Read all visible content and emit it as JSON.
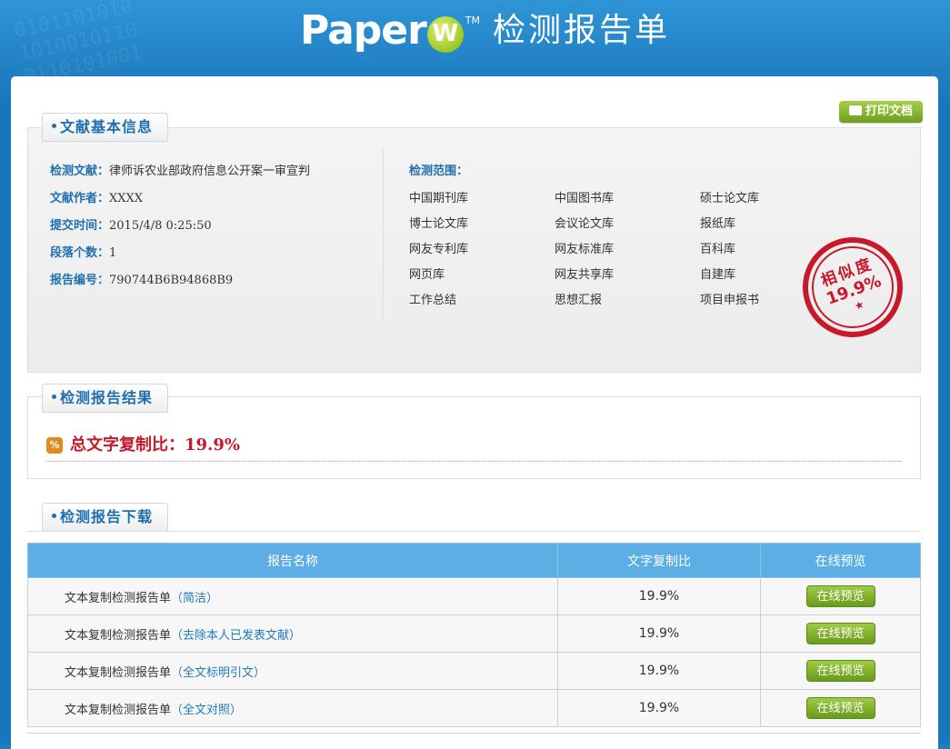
{
  "header": {
    "logo_text": "Paper",
    "logo_mark": "W",
    "logo_tm": "TM",
    "title": "检测报告单"
  },
  "toolbar": {
    "print_label": "打印文档"
  },
  "info": {
    "section_title": "文献基本信息",
    "rows": [
      {
        "label": "检测文献：",
        "value": "律师诉农业部政府信息公开案一审宣判"
      },
      {
        "label": "文献作者：",
        "value": "XXXX"
      },
      {
        "label": "提交时间：",
        "value": "2015/4/8 0:25:50"
      },
      {
        "label": "段落个数：",
        "value": "1"
      },
      {
        "label": "报告编号：",
        "value": "790744B6B94868B9"
      }
    ],
    "scope_label": "检测范围：",
    "scope": [
      "中国期刊库",
      "中国图书库",
      "硕士论文库",
      "博士论文库",
      "会议论文库",
      "报纸库",
      "网友专利库",
      "网友标准库",
      "百科库",
      "网页库",
      "网友共享库",
      "自建库",
      "工作总结",
      "思想汇报",
      "项目申报书"
    ],
    "stamp": {
      "title": "相似度",
      "value": "19.9%",
      "star": "★"
    }
  },
  "result": {
    "section_title": "检测报告结果",
    "icon": "%",
    "label": "总文字复制比：",
    "value": "19.9%"
  },
  "download": {
    "section_title": "检测报告下载",
    "columns": [
      "报告名称",
      "文字复制比",
      "在线预览"
    ],
    "rows": [
      {
        "name": "文本复制检测报告单",
        "sub": "（简洁）",
        "ratio": "19.9%",
        "action": "在线预览"
      },
      {
        "name": "文本复制检测报告单",
        "sub": "（去除本人已发表文献）",
        "ratio": "19.9%",
        "action": "在线预览"
      },
      {
        "name": "文本复制检测报告单",
        "sub": "（全文标明引文）",
        "ratio": "19.9%",
        "action": "在线预览"
      },
      {
        "name": "文本复制检测报告单",
        "sub": "（全文对照）",
        "ratio": "19.9%",
        "action": "在线预览"
      }
    ]
  },
  "colors": {
    "accent": "#1f6fb0",
    "header_bg": "#1a76ba",
    "table_head": "#5eaee6",
    "stamp": "#c8192b",
    "button": "#7fb02a"
  }
}
